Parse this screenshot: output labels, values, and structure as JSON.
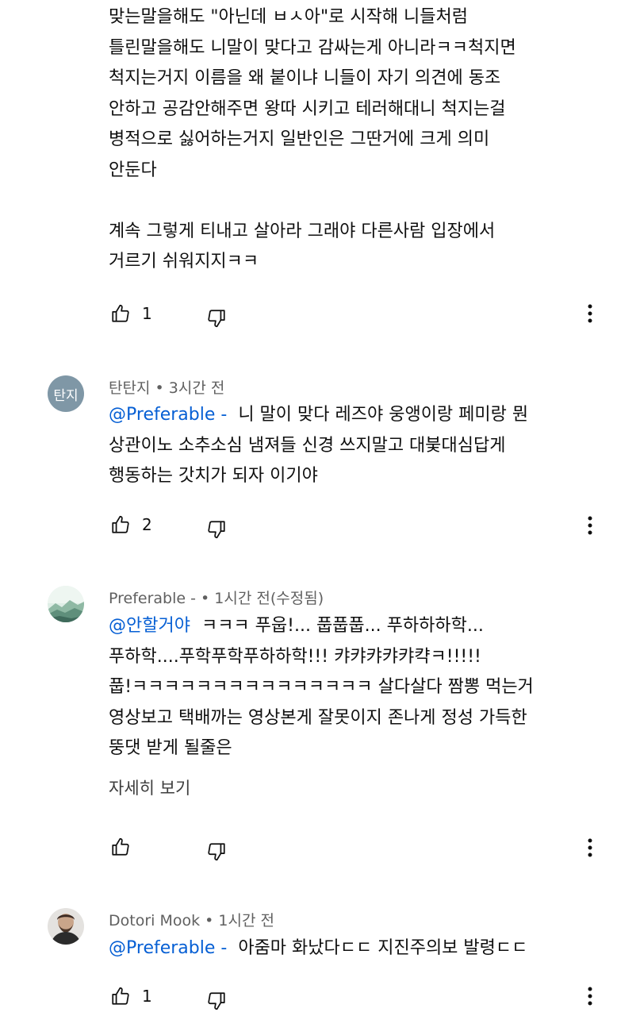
{
  "comments": [
    {
      "body_lines": [
        "맞는말을해도 \"아닌데 ㅂㅅ아\"로 시작해 니들처럼",
        "틀린말을해도 니말이 맞다고 감싸는게 아니라ㅋㅋ척지면",
        "척지는거지 이름을 왜 붙이냐 니들이 자기 의견에 동조",
        "안하고 공감안해주면 왕따 시키고 테러해대니 척지는걸",
        "병적으로 싫어하는거지 일반인은 그딴거에 크게 의미",
        "안둔다",
        "",
        "계속 그렇게 티내고 살아라 그래야 다른사람 입장에서",
        "거르기 쉬워지지ㅋㅋ"
      ],
      "likes": "1"
    },
    {
      "avatar_text": "탄지",
      "author": "탄탄지",
      "time": "3시간 전",
      "mention": "@Preferable -",
      "body_first": "  니 말이 맞다 레즈야 웅앵이랑 페미랑 뭔",
      "body_rest": [
        "상관이노 소추소심 냄져들 신경 쓰지말고 대붖대심답게",
        "행동하는 갓치가 되자 이기야"
      ],
      "likes": "2"
    },
    {
      "author": "Preferable - ",
      "time": "1시간 전(수정됨)",
      "mention": "@안할거야",
      "body_first": "  ㅋㅋㅋ 푸웁!... 풉풉풉... 푸하하하학...",
      "body_rest": [
        "푸하학....푸학푸학푸하하학!!! 캬캬캬캬캬캭ㅋ!!!!!",
        "풉!ㅋㅋㅋㅋㅋㅋㅋㅋㅋㅋㅋㅋㅋㅋㅋ 살다살다 짬뽕 먹는거",
        "영상보고 택배까는 영상본게 잘못이지 존나게 정성 가득한",
        "뚱댓 받게 될줄은"
      ],
      "read_more": "자세히 보기",
      "likes": ""
    },
    {
      "author": "Dotori Mook",
      "time": "1시간 전",
      "mention": "@Preferable -",
      "body_first": "  아줌마 화났다ㄷㄷ 지진주의보 발령ㄷㄷ",
      "likes": "1"
    }
  ],
  "meta_separator": "•",
  "icons": {
    "like": "thumb-up-icon",
    "dislike": "thumb-down-icon",
    "more": "more-vert-icon"
  }
}
